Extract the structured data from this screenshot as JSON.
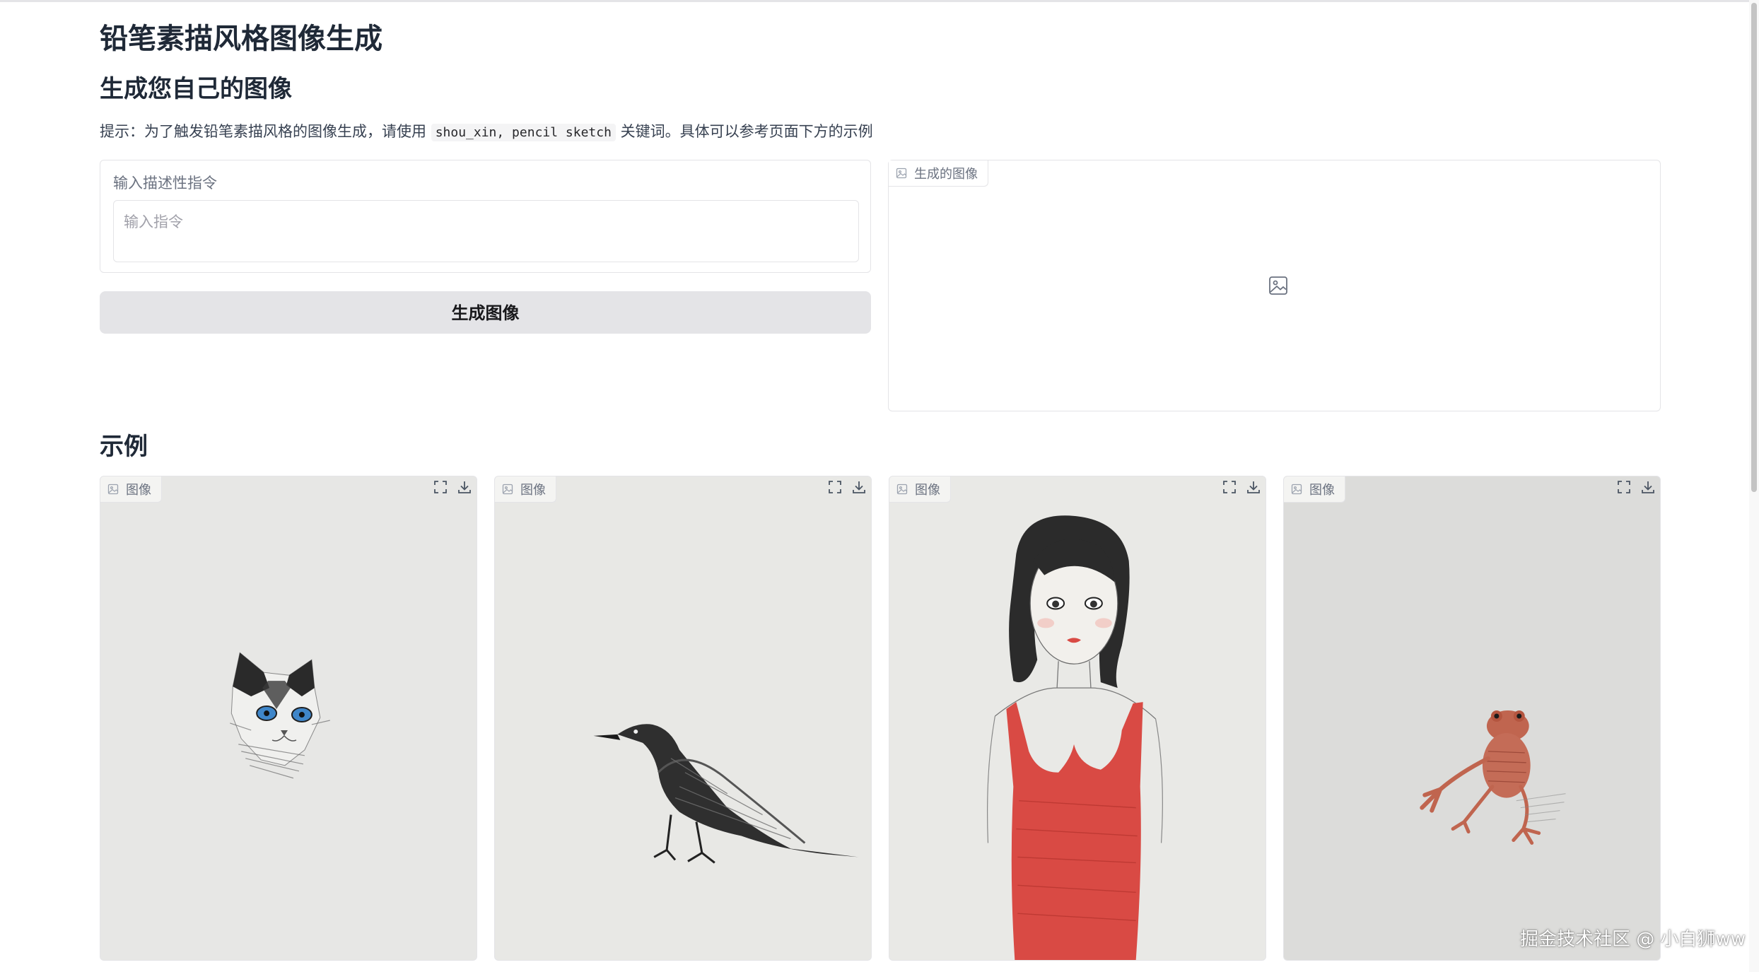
{
  "page": {
    "title": "铅笔素描风格图像生成",
    "subtitle": "生成您自己的图像",
    "hint": {
      "prefix": "提示：为了触发铅笔素描风格的图像生成，请使用",
      "keywords": "shou_xin, pencil sketch",
      "suffix": "关键词。具体可以参考页面下方的示例"
    }
  },
  "prompt": {
    "label": "输入描述性指令",
    "value": "",
    "placeholder": "输入指令"
  },
  "generate_button": {
    "label": "生成图像"
  },
  "output": {
    "label": "生成的图像",
    "icon": "image-icon"
  },
  "examples": {
    "title": "示例",
    "items": [
      {
        "label": "图像",
        "subject": "cat"
      },
      {
        "label": "图像",
        "subject": "crow"
      },
      {
        "label": "图像",
        "subject": "girl"
      },
      {
        "label": "图像",
        "subject": "frog"
      }
    ]
  },
  "watermark": "掘金技术社区 @ 小白狮ww",
  "colors": {
    "button_bg": "#e4e4e7",
    "border": "#e4e4e7",
    "dress_red": "#d94a44",
    "frog_red": "#c0654f",
    "cat_eye_blue": "#3f86c9"
  }
}
